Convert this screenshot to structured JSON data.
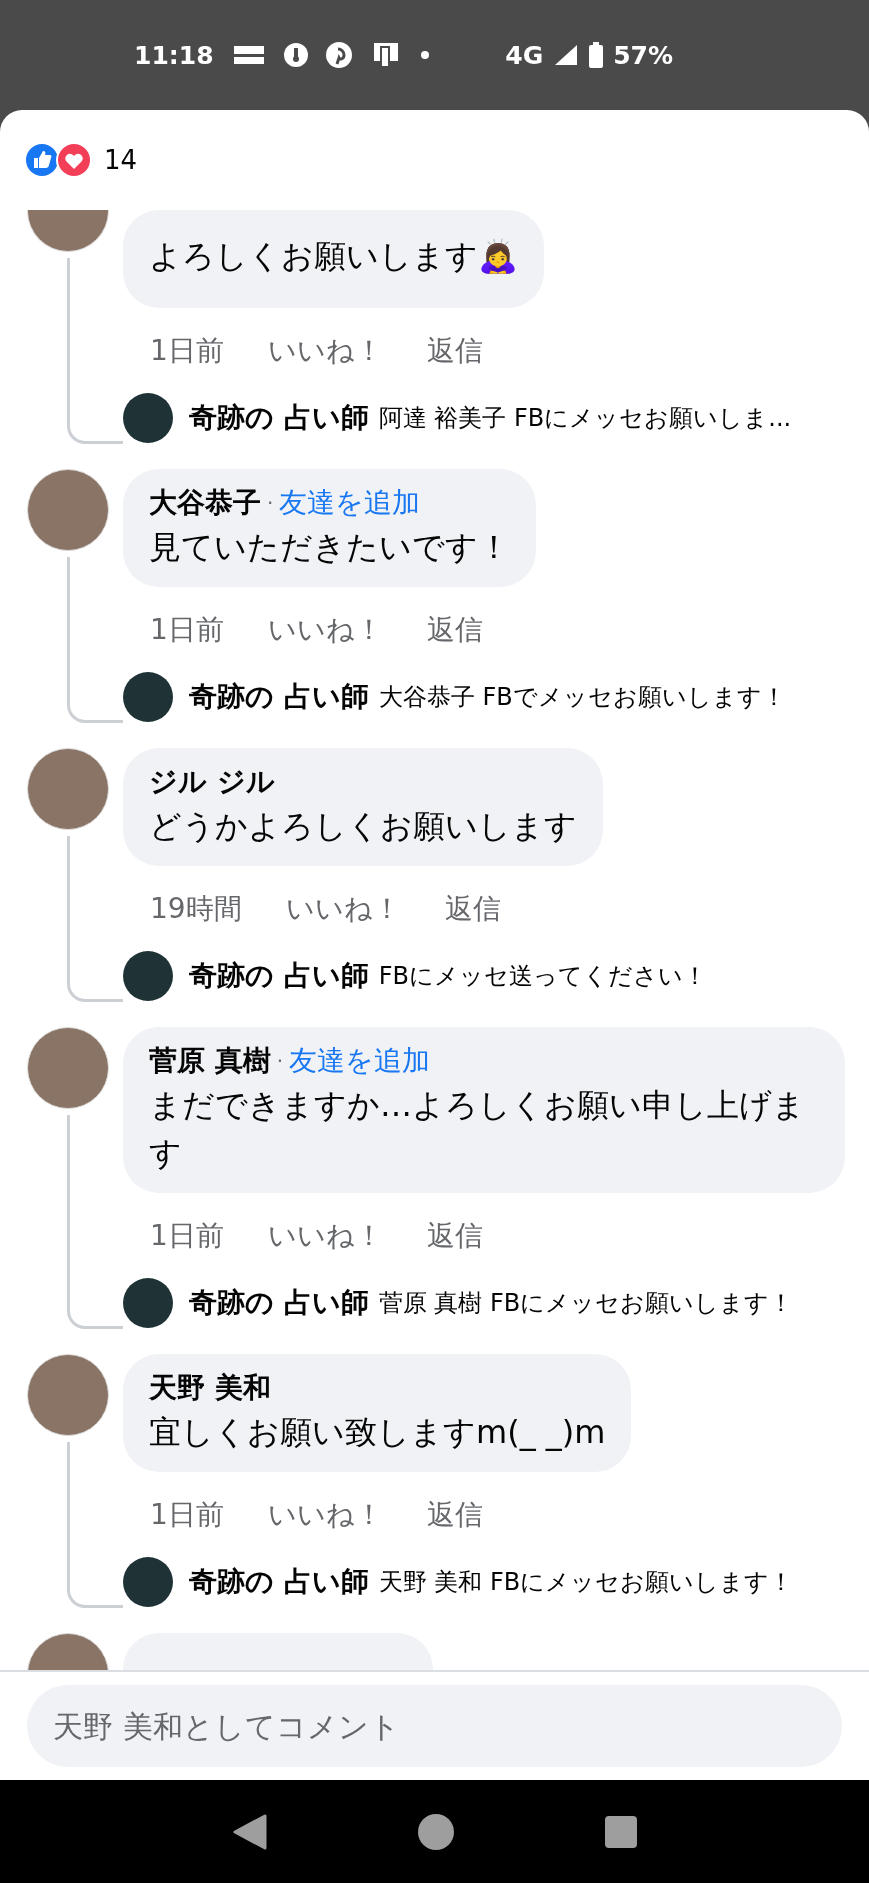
{
  "status_bar": {
    "time": "11:18",
    "network": "4G",
    "battery": "57%"
  },
  "reactions": {
    "count": "14"
  },
  "comments": [
    {
      "kind": "cut_top",
      "text": "よろしくお願いします🙇‍♀️",
      "time": "1日前",
      "like": "いいね！",
      "reply_label": "返信",
      "reply": {
        "name": "奇跡の 占い師",
        "text": "阿達 裕美子 FBにメッセお願いしま..."
      }
    },
    {
      "kind": "full",
      "name": "大谷恭子",
      "dot": "·",
      "add_friend": "友達を追加",
      "text": "見ていただきたいです！",
      "time": "1日前",
      "like": "いいね！",
      "reply_label": "返信",
      "reply": {
        "name": "奇跡の 占い師",
        "text": "大谷恭子 FBでメッセお願いします！"
      }
    },
    {
      "kind": "full",
      "name": "ジル ジル",
      "text": "どうかよろしくお願いします",
      "time": "19時間",
      "like": "いいね！",
      "reply_label": "返信",
      "reply": {
        "name": "奇跡の 占い師",
        "text": "FBにメッセ送ってください！"
      }
    },
    {
      "kind": "full",
      "name": "菅原 真樹",
      "dot": "·",
      "add_friend": "友達を追加",
      "text": "まだできますか…よろしくお願い申し上げます",
      "time": "1日前",
      "like": "いいね！",
      "reply_label": "返信",
      "reply": {
        "name": "奇跡の 占い師",
        "text": "菅原 真樹 FBにメッセお願いします！"
      }
    },
    {
      "kind": "full",
      "name": "天野 美和",
      "text": "宜しくお願い致しますm(_ _)m",
      "time": "1日前",
      "like": "いいね！",
      "reply_label": "返信",
      "reply": {
        "name": "奇跡の 占い師",
        "text": "天野 美和 FBにメッセお願いします！"
      }
    },
    {
      "kind": "clipped"
    }
  ],
  "composer": {
    "placeholder": "天野 美和としてコメント"
  }
}
